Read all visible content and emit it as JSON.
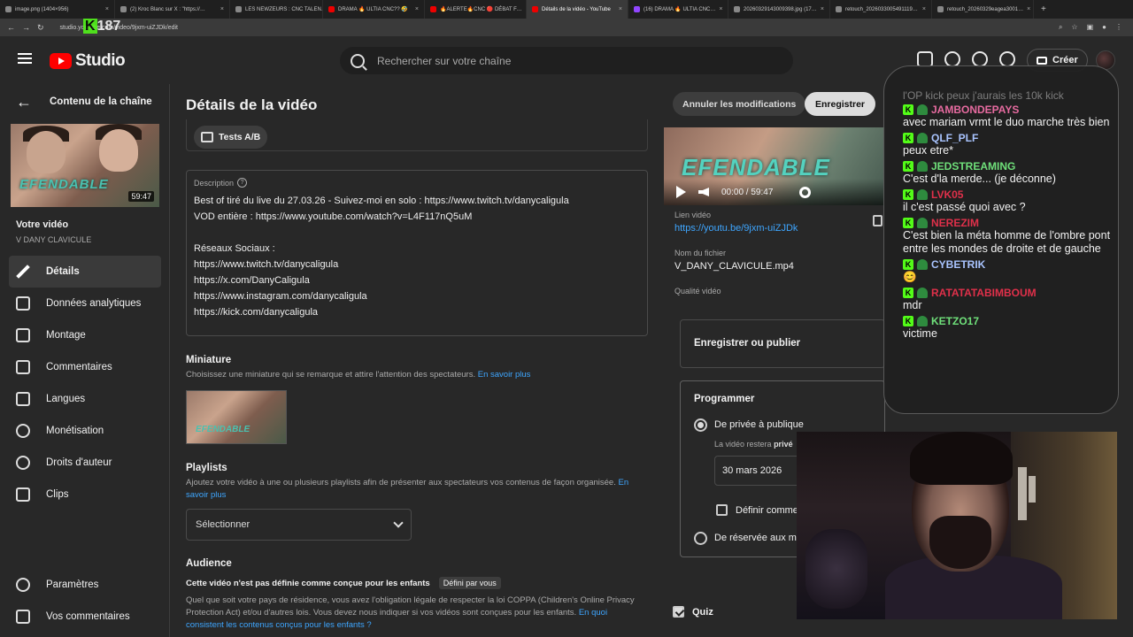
{
  "browser": {
    "tabs": [
      {
        "title": "image.png (1404×956)",
        "favicon": "image"
      },
      {
        "title": "(2) Kroc Blanc sur X : \"https://…",
        "favicon": "x"
      },
      {
        "title": "LES NEWZEURS : CNC TALEN…",
        "favicon": "image"
      },
      {
        "title": "DRAMA 🔥 ULTIA CNC?? 🤣",
        "favicon": "yt"
      },
      {
        "title": "🔥ALERTE🔥CNC 🔴 DÉBAT F…",
        "favicon": "yt"
      },
      {
        "title": "Détails de la vidéo - YouTube",
        "favicon": "yt",
        "active": true
      },
      {
        "title": "(16) DRAMA 🔥 ULTIA CNC…",
        "favicon": "tw"
      },
      {
        "title": "20260329143009398.jpg (17…",
        "favicon": "image"
      },
      {
        "title": "retouch_2026033005491119…",
        "favicon": "image"
      },
      {
        "title": "retouch_20260329eagea3001…",
        "favicon": "image"
      }
    ],
    "url": "studio.youtube.com/video/9jxm-uiZJDk/edit",
    "watermark_letter": "K",
    "watermark_text": "187"
  },
  "header": {
    "logo_text": "Studio",
    "search_placeholder": "Rechercher sur votre chaîne",
    "create_label": "Créer"
  },
  "sidebar": {
    "back_label": "Contenu de la chaîne",
    "thumbnail_brand": "EFENDABLE",
    "duration": "59:47",
    "your_video_label": "Votre vidéo",
    "channel_name": "V DANY CLAVICULE",
    "items": [
      {
        "label": "Détails",
        "icon": "pencil-icon",
        "active": true
      },
      {
        "label": "Données analytiques",
        "icon": "analytics-icon"
      },
      {
        "label": "Montage",
        "icon": "editor-icon"
      },
      {
        "label": "Commentaires",
        "icon": "comments-icon"
      },
      {
        "label": "Langues",
        "icon": "subtitles-icon"
      },
      {
        "label": "Monétisation",
        "icon": "dollar-icon"
      },
      {
        "label": "Droits d'auteur",
        "icon": "copyright-icon"
      },
      {
        "label": "Clips",
        "icon": "scissors-icon"
      }
    ],
    "bottom_items": [
      {
        "label": "Paramètres",
        "icon": "gear-icon"
      },
      {
        "label": "Vos commentaires",
        "icon": "feedback-icon"
      }
    ]
  },
  "main": {
    "title": "Détails de la vidéo",
    "cancel_label": "Annuler les modifications",
    "save_label": "Enregistrer",
    "ab_test_label": "Tests A/B",
    "description_label": "Description",
    "description_lines": [
      "Best of tiré du live du 27.03.26 - Suivez-moi en solo :   https://www.twitch.tv/danycaligula",
      "VOD entière : https://www.youtube.com/watch?v=L4F117nQ5uM",
      "",
      "Réseaux Sociaux :",
      "https://www.twitch.tv/danycaligula",
      "https://x.com/DanyCaligula",
      "https://www.instagram.com/danycaligula",
      "https://kick.com/danycaligula"
    ],
    "thumbnail_title": "Miniature",
    "thumbnail_sub": "Choisissez une miniature qui se remarque et attire l'attention des spectateurs.",
    "learn_more": "En savoir plus",
    "playlists_title": "Playlists",
    "playlists_sub": "Ajoutez votre vidéo à une ou plusieurs playlists afin de présenter aux spectateurs vos contenus de façon organisée.",
    "playlists_learn_more_1": "En",
    "playlists_learn_more_2": "savoir plus",
    "playlist_select": "Sélectionner",
    "audience_title": "Audience",
    "audience_status": "Cette vidéo n'est pas définie comme conçue pour les enfants",
    "audience_badge": "Défini par vous",
    "audience_sub": "Quel que soit votre pays de résidence, vous avez l'obligation légale de respecter la loi COPPA (Children's Online Privacy Protection Act) et/ou d'autres lois. Vous devez nous indiquer si vos vidéos sont conçues pour les enfants.",
    "audience_link": "En quoi consistent les contenus conçus pour les enfants ?"
  },
  "right": {
    "preview_brand": "EFENDABLE",
    "time": "00:00 / 59:47",
    "link_label": "Lien vidéo",
    "link_value": "https://youtu.be/9jxm-uiZJDk",
    "file_label": "Nom du fichier",
    "file_value": "V_DANY_CLAVICULE.mp4",
    "quality_label": "Qualité vidéo",
    "publish_label": "Enregistrer ou publier",
    "schedule_title": "Programmer",
    "private_to_public": "De privée à publique",
    "stays_text": "La vidéo restera",
    "stays_bold": "privé",
    "date_value": "30 mars 2026",
    "premiere_label": "Définir comme",
    "reserved_label": "De réservée aux me",
    "quiz_label": "Quiz"
  },
  "chat": {
    "top_fade": "l'OP kick peux j'aurais les 10k kick",
    "messages": [
      {
        "user": "JAMBONDEPAYS",
        "color": "#e76ba0",
        "text": "avec mariam vrmt le duo marche très bien"
      },
      {
        "user": "QLF_PLF",
        "color": "#a9c4ff",
        "text": "peux etre*"
      },
      {
        "user": "JEDSTREAMING",
        "color": "#6fe07a",
        "text": "C'est d'la merde... (je déconne)"
      },
      {
        "user": "LVK05",
        "color": "#e0304a",
        "text": "il c'est passé quoi avec ?"
      },
      {
        "user": "NEREZIM",
        "color": "#e0304a",
        "text": "C'est bien la méta homme de l'ombre pont entre les mondes de droite et de gauche"
      },
      {
        "user": "CYBETRIK",
        "color": "#a9c4ff",
        "text": "😊"
      },
      {
        "user": "RATATATABIMBOUM",
        "color": "#e0304a",
        "text": "mdr"
      },
      {
        "user": "KETZO17",
        "color": "#6fe07a",
        "text": "victime"
      }
    ]
  }
}
